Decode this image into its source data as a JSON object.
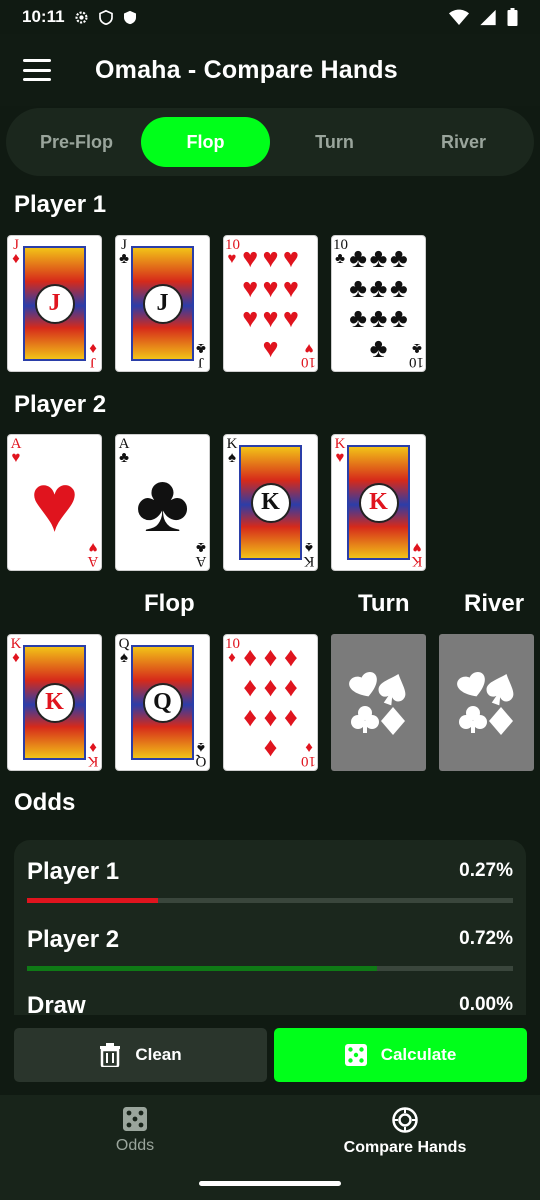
{
  "status_bar": {
    "time": "10:11",
    "icons": [
      "gear-icon",
      "shield-icon",
      "shield-filled-icon",
      "wifi-icon",
      "signal-icon",
      "battery-icon"
    ]
  },
  "app_bar": {
    "title": "Omaha - Compare Hands",
    "menu_icon": "menu-icon"
  },
  "stage_tabs": [
    {
      "label": "Pre-Flop",
      "active": false
    },
    {
      "label": "Flop",
      "active": true
    },
    {
      "label": "Turn",
      "active": false
    },
    {
      "label": "River",
      "active": false
    }
  ],
  "player1": {
    "title": "Player 1",
    "cards": [
      {
        "rank": "J",
        "suit": "♦",
        "color": "red"
      },
      {
        "rank": "J",
        "suit": "♣",
        "color": "black"
      },
      {
        "rank": "10",
        "suit": "♥",
        "color": "red"
      },
      {
        "rank": "10",
        "suit": "♣",
        "color": "black"
      }
    ]
  },
  "player2": {
    "title": "Player 2",
    "cards": [
      {
        "rank": "A",
        "suit": "♥",
        "color": "red"
      },
      {
        "rank": "A",
        "suit": "♣",
        "color": "black"
      },
      {
        "rank": "K",
        "suit": "♠",
        "color": "black"
      },
      {
        "rank": "K",
        "suit": "♥",
        "color": "red"
      }
    ]
  },
  "board": {
    "flop_label": "Flop",
    "turn_label": "Turn",
    "river_label": "River",
    "flop_cards": [
      {
        "rank": "K",
        "suit": "♦",
        "color": "red"
      },
      {
        "rank": "Q",
        "suit": "♠",
        "color": "black"
      },
      {
        "rank": "10",
        "suit": "♦",
        "color": "red"
      }
    ],
    "turn_empty": true,
    "river_empty": true
  },
  "odds": {
    "title": "Odds",
    "rows": [
      {
        "name": "Player 1",
        "pct": "0.27%",
        "fill": 0.27,
        "color": "#e0141e"
      },
      {
        "name": "Player 2",
        "pct": "0.72%",
        "fill": 0.72,
        "color": "#0f7a16"
      },
      {
        "name": "Draw",
        "pct": "0.00%",
        "fill": 0.0,
        "color": "#3a463c"
      }
    ]
  },
  "actions": {
    "clean_label": "Clean",
    "calculate_label": "Calculate"
  },
  "bottom_nav": [
    {
      "label": "Odds",
      "active": false,
      "icon": "dice-icon"
    },
    {
      "label": "Compare Hands",
      "active": true,
      "icon": "chip-icon"
    }
  ],
  "colors": {
    "accent": "#00ff1a",
    "background": "#101a12",
    "panel": "#1b271d"
  }
}
